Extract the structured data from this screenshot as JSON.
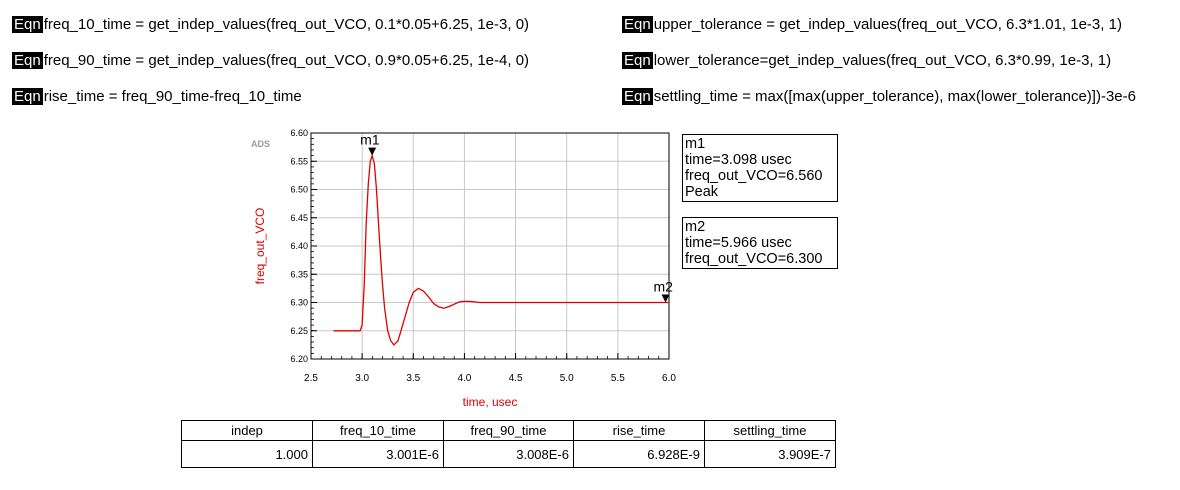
{
  "equations": [
    {
      "tag": "Eqn",
      "text": "freq_10_time = get_indep_values(freq_out_VCO, 0.1*0.05+6.25, 1e-3, 0)"
    },
    {
      "tag": "Eqn",
      "text": "freq_90_time = get_indep_values(freq_out_VCO, 0.9*0.05+6.25, 1e-4, 0)"
    },
    {
      "tag": "Eqn",
      "text": "rise_time = freq_90_time-freq_10_time"
    },
    {
      "tag": "Eqn",
      "text": "upper_tolerance = get_indep_values(freq_out_VCO, 6.3*1.01, 1e-3, 1)"
    },
    {
      "tag": "Eqn",
      "text": "lower_tolerance=get_indep_values(freq_out_VCO, 6.3*0.99, 1e-3, 1)"
    },
    {
      "tag": "Eqn",
      "text": "settling_time = max([max(upper_tolerance), max(lower_tolerance)])-3e-6"
    }
  ],
  "watermark": "ADS",
  "chart_data": {
    "type": "line",
    "xlabel": "time, usec",
    "ylabel": "freq_out_VCO",
    "xlim": [
      2.5,
      6.0
    ],
    "ylim": [
      6.2,
      6.6
    ],
    "x_ticks": [
      "2.5",
      "3.0",
      "3.5",
      "4.0",
      "4.5",
      "5.0",
      "5.5",
      "6.0"
    ],
    "y_ticks": [
      "6.20",
      "6.25",
      "6.30",
      "6.35",
      "6.40",
      "6.45",
      "6.50",
      "6.55",
      "6.60"
    ],
    "grid": true,
    "series": [
      {
        "color": "#e00000",
        "x": [
          2.72,
          2.8,
          2.9,
          2.98,
          3.0,
          3.02,
          3.04,
          3.06,
          3.08,
          3.098,
          3.12,
          3.14,
          3.16,
          3.18,
          3.2,
          3.22,
          3.25,
          3.28,
          3.31,
          3.35,
          3.38,
          3.42,
          3.46,
          3.5,
          3.55,
          3.6,
          3.65,
          3.7,
          3.75,
          3.8,
          3.85,
          3.9,
          3.95,
          4.0,
          4.05,
          4.1,
          4.15,
          4.2,
          4.3,
          4.5,
          5.0,
          5.5,
          6.0
        ],
        "y": [
          6.25,
          6.25,
          6.25,
          6.25,
          6.26,
          6.33,
          6.44,
          6.51,
          6.55,
          6.56,
          6.545,
          6.5,
          6.44,
          6.38,
          6.33,
          6.29,
          6.25,
          6.232,
          6.225,
          6.232,
          6.25,
          6.275,
          6.3,
          6.318,
          6.325,
          6.32,
          6.31,
          6.298,
          6.292,
          6.29,
          6.293,
          6.297,
          6.301,
          6.302,
          6.302,
          6.301,
          6.3,
          6.3,
          6.3,
          6.3,
          6.3,
          6.3,
          6.3
        ]
      }
    ],
    "markers": [
      {
        "name": "m1",
        "x": 3.098,
        "y": 6.56,
        "lines": [
          "m1",
          "time=3.098 usec",
          "freq_out_VCO=6.560",
          "Peak"
        ]
      },
      {
        "name": "m2",
        "x": 5.966,
        "y": 6.3,
        "lines": [
          "m2",
          "time=5.966 usec",
          "freq_out_VCO=6.300"
        ]
      }
    ]
  },
  "results_table": {
    "headers": [
      "indep",
      "freq_10_time",
      "freq_90_time",
      "rise_time",
      "settling_time"
    ],
    "rows": [
      [
        "1.000",
        "3.001E-6",
        "3.008E-6",
        "6.928E-9",
        "3.909E-7"
      ]
    ]
  }
}
